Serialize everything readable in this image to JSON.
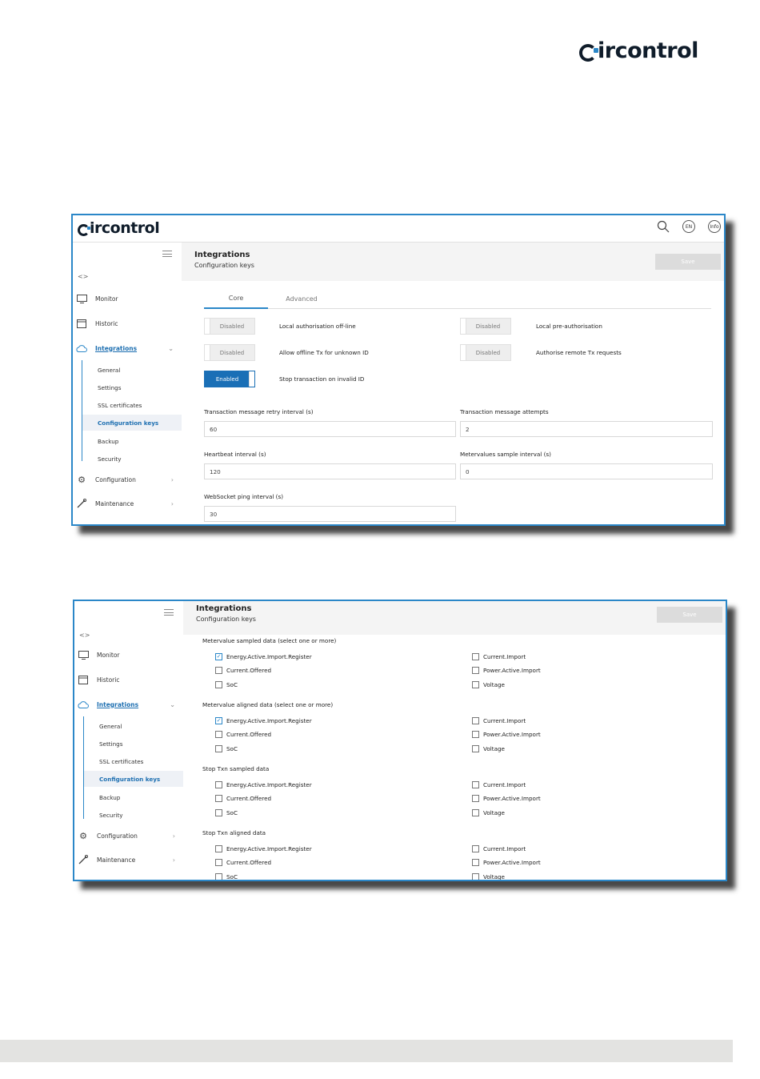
{
  "brand": {
    "logo_text": "ircontrol",
    "logo_full": "circontrol",
    "accent": "#2b87c8",
    "dark": "#0f1c2a"
  },
  "topbar": {
    "language": "EN",
    "info": "Info",
    "search_icon": "search-icon"
  },
  "sidebar": {
    "collapse_glyph": "<>",
    "items": [
      {
        "label": "Monitor",
        "icon": "monitor-icon"
      },
      {
        "label": "Historic",
        "icon": "calendar-icon"
      },
      {
        "label": "Integrations",
        "icon": "cloud-icon"
      },
      {
        "label": "Configuration",
        "icon": "gear-icon"
      },
      {
        "label": "Maintenance",
        "icon": "wrench-icon"
      }
    ],
    "subitems": [
      "General",
      "Settings",
      "SSL certificates",
      "Configuration keys",
      "Backup",
      "Security"
    ]
  },
  "header": {
    "title": "Integrations",
    "subtitle": "Configuration keys",
    "save": "Save"
  },
  "tabs": [
    "Core",
    "Advanced"
  ],
  "toggles": [
    {
      "state": "Disabled",
      "label": "Local authorisation off-line"
    },
    {
      "state": "Disabled",
      "label": "Local pre-authorisation"
    },
    {
      "state": "Disabled",
      "label": "Allow offline Tx for unknown ID"
    },
    {
      "state": "Disabled",
      "label": "Authorise remote Tx requests"
    },
    {
      "state": "Enabled",
      "label": "Stop transaction on invalid ID"
    }
  ],
  "fields": [
    {
      "label": "Transaction message retry interval (s)",
      "value": "60"
    },
    {
      "label": "Transaction message attempts",
      "value": "2"
    },
    {
      "label": "Heartbeat interval (s)",
      "value": "120"
    },
    {
      "label": "Metervalues sample interval (s)",
      "value": "0"
    },
    {
      "label": "WebSocket ping interval (s)",
      "value": "30"
    }
  ],
  "groups": [
    {
      "label": "Metervalue sampled data (select one or more)",
      "options": [
        {
          "label": "Energy.Active.Import.Register",
          "checked": true
        },
        {
          "label": "Current.Import",
          "checked": false
        },
        {
          "label": "Current.Offered",
          "checked": false
        },
        {
          "label": "Power.Active.Import",
          "checked": false
        },
        {
          "label": "SoC",
          "checked": false
        },
        {
          "label": "Voltage",
          "checked": false
        }
      ]
    },
    {
      "label": "Metervalue aligned data (select one or more)",
      "options": [
        {
          "label": "Energy.Active.Import.Register",
          "checked": true
        },
        {
          "label": "Current.Import",
          "checked": false
        },
        {
          "label": "Current.Offered",
          "checked": false
        },
        {
          "label": "Power.Active.Import",
          "checked": false
        },
        {
          "label": "SoC",
          "checked": false
        },
        {
          "label": "Voltage",
          "checked": false
        }
      ]
    },
    {
      "label": "Stop Txn sampled data",
      "options": [
        {
          "label": "Energy.Active.Import.Register",
          "checked": false
        },
        {
          "label": "Current.Import",
          "checked": false
        },
        {
          "label": "Current.Offered",
          "checked": false
        },
        {
          "label": "Power.Active.Import",
          "checked": false
        },
        {
          "label": "SoC",
          "checked": false
        },
        {
          "label": "Voltage",
          "checked": false
        }
      ]
    },
    {
      "label": "Stop Txn aligned data",
      "options": [
        {
          "label": "Energy.Active.Import.Register",
          "checked": false
        },
        {
          "label": "Current.Import",
          "checked": false
        },
        {
          "label": "Current.Offered",
          "checked": false
        },
        {
          "label": "Power.Active.Import",
          "checked": false
        },
        {
          "label": "SoC",
          "checked": false
        },
        {
          "label": "Voltage",
          "checked": false
        }
      ]
    }
  ],
  "check_glyph": "✓"
}
